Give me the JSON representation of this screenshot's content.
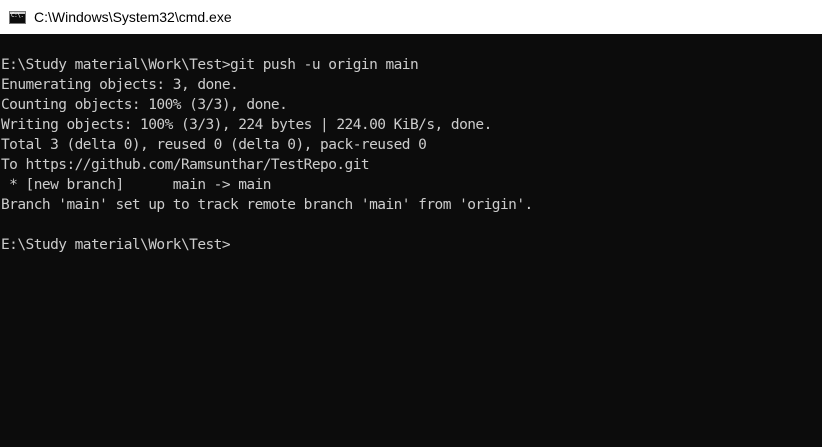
{
  "window": {
    "title": "C:\\Windows\\System32\\cmd.exe",
    "icon": "cmd-icon",
    "icon_text": "C:\\."
  },
  "console": {
    "lines": [
      "E:\\Study material\\Work\\Test>git push -u origin main",
      "Enumerating objects: 3, done.",
      "Counting objects: 100% (3/3), done.",
      "Writing objects: 100% (3/3), 224 bytes | 224.00 KiB/s, done.",
      "Total 3 (delta 0), reused 0 (delta 0), pack-reused 0",
      "To https://github.com/Ramsunthar/TestRepo.git",
      " * [new branch]      main -> main",
      "Branch 'main' set up to track remote branch 'main' from 'origin'.",
      "",
      "E:\\Study material\\Work\\Test>"
    ]
  },
  "colors": {
    "background": "#0c0c0c",
    "text": "#cccccc",
    "titlebar": "#ffffff"
  }
}
